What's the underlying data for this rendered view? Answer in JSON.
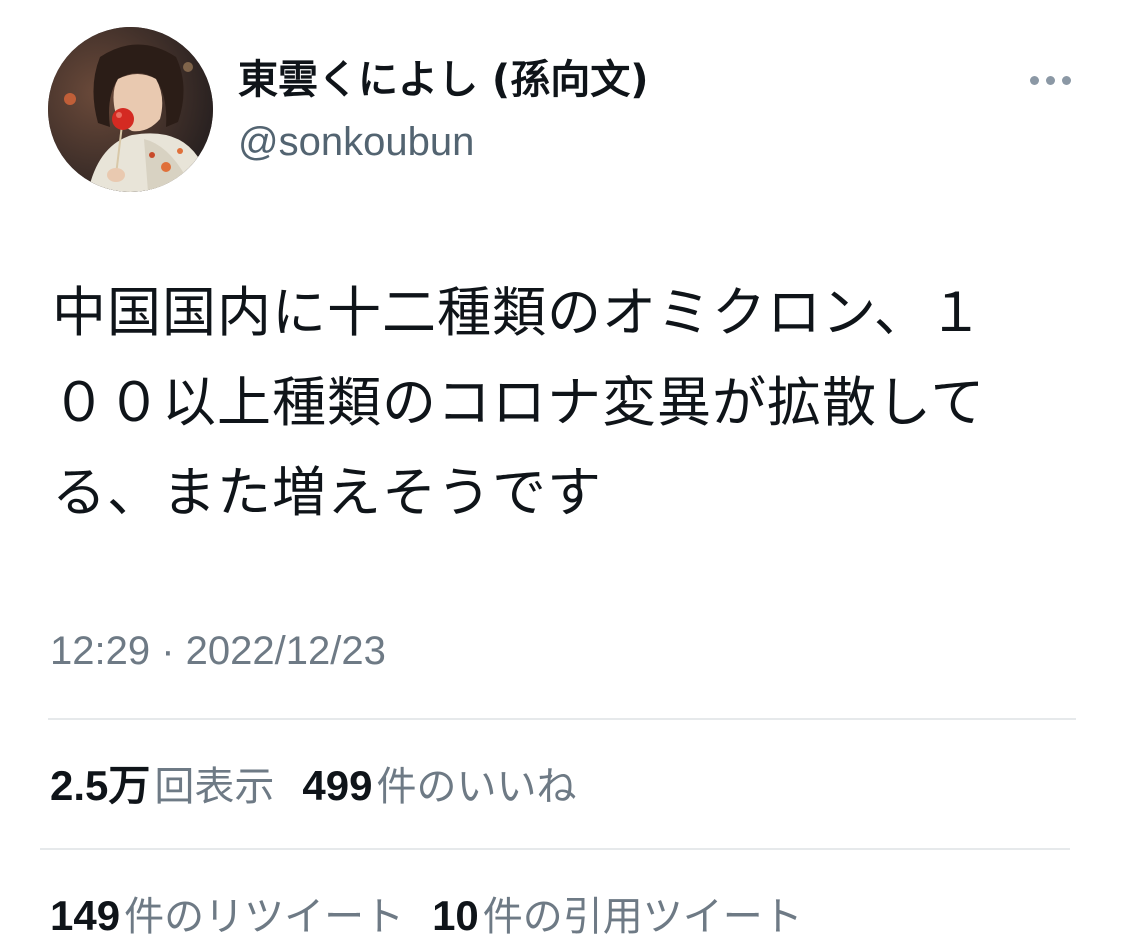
{
  "author": {
    "display_name": "東雲くによし (孫向文)",
    "handle": "@sonkoubun",
    "avatar_icon": "avatar-illustration-girl-with-candy-apple"
  },
  "more_icon": "more-horizontal-icon",
  "tweet": {
    "text": "中国国内に十二種類のオミクロン、１００以上種類のコロナ変異が拡散してる、また増えそうです",
    "timestamp": "12:29 · 2022/12/23"
  },
  "stats": {
    "views": {
      "count": "2.5万",
      "label": "回表示"
    },
    "likes": {
      "count": "499",
      "label": "件のいいね"
    },
    "retweets": {
      "count": "149",
      "label": "件のリツイート"
    },
    "quotes": {
      "count": "10",
      "label": "件の引用ツイート"
    }
  },
  "colors": {
    "primary_text": "#0f1419",
    "secondary_text": "#6e7a85",
    "divider": "#e6e9eb",
    "background": "#ffffff"
  }
}
